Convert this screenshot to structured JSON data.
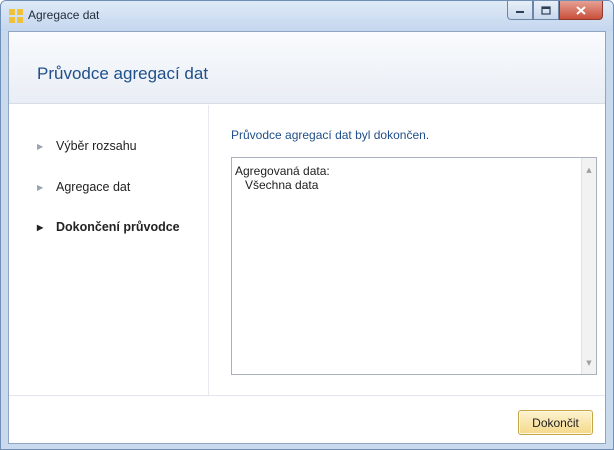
{
  "window": {
    "title": "Agregace dat",
    "minimize_icon": "minimize-icon",
    "maximize_icon": "maximize-icon",
    "close_icon": "close-icon"
  },
  "wizard": {
    "title": "Průvodce agregací dat",
    "steps": [
      {
        "label": "Výběr rozsahu",
        "active": false
      },
      {
        "label": "Agregace dat",
        "active": false
      },
      {
        "label": "Dokončení průvodce",
        "active": true
      }
    ],
    "message": "Průvodce agregací dat byl dokončen.",
    "summary_lines": [
      "Agregovaná data:",
      "   Všechna data"
    ],
    "finish_label": "Dokončit"
  },
  "colors": {
    "accent_text": "#1f4f8a",
    "finish_button": "#f4d98a",
    "close_button": "#c94f3b"
  }
}
